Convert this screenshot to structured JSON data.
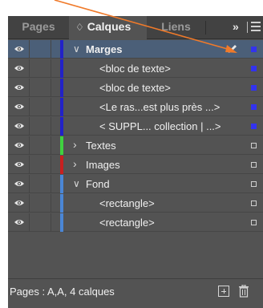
{
  "tabs": {
    "pages": "Pages",
    "calques": "Calques",
    "calques_icon": "♢",
    "liens": "Liens",
    "more": "»"
  },
  "layers": [
    {
      "label": "Marges",
      "kind": "layer",
      "expanded": true,
      "color": "#2222c8",
      "selected": true,
      "square": "filled"
    },
    {
      "label": "<bloc de texte>",
      "kind": "child",
      "color": "#2222c8",
      "square": "filled"
    },
    {
      "label": "<bloc de texte>",
      "kind": "child",
      "color": "#2222c8",
      "square": "filled"
    },
    {
      "label": "<Le ras...est plus près ...>",
      "kind": "child",
      "color": "#2222c8",
      "square": "filled"
    },
    {
      "label": "< SUPPL... collection | ...>",
      "kind": "child",
      "color": "#2222c8",
      "square": "filled"
    },
    {
      "label": "Textes",
      "kind": "layer",
      "expanded": false,
      "color": "#3fd23f",
      "square": "empty"
    },
    {
      "label": "Images",
      "kind": "layer",
      "expanded": false,
      "color": "#c82020",
      "square": "empty"
    },
    {
      "label": "Fond",
      "kind": "layer",
      "expanded": true,
      "color": "#4a86d6",
      "square": "empty"
    },
    {
      "label": "<rectangle>",
      "kind": "child",
      "color": "#4a86d6",
      "square": "empty"
    },
    {
      "label": "<rectangle>",
      "kind": "child",
      "color": "#4a86d6",
      "square": "empty"
    }
  ],
  "footer": {
    "status": "Pages : A,A, 4 calques"
  },
  "colors": {
    "panel_bg": "#535353",
    "selected_row": "#4b5f78",
    "annotation_arrow": "#f07a2a"
  }
}
